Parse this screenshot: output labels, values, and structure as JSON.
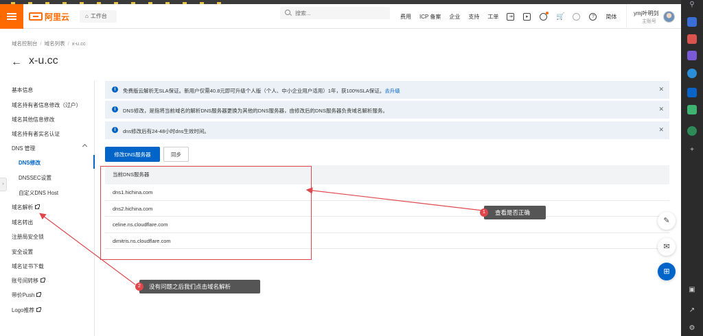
{
  "header": {
    "logo_text": "阿里云",
    "workbench": "工作台",
    "search_placeholder": "搜索...",
    "nav": [
      "费用",
      "ICP 备案",
      "企业",
      "支持",
      "工单"
    ],
    "lang": "简体",
    "user_name": "ymj叶明剑",
    "user_sub": "主账号"
  },
  "breadcrumb": [
    "域名控制台",
    "域名列表",
    "x-u.cc"
  ],
  "page_title": "x-u.cc",
  "sidebar": {
    "items": [
      {
        "label": "基本信息"
      },
      {
        "label": "域名持有者信息修改（过户）"
      },
      {
        "label": "域名其他信息修改"
      },
      {
        "label": "域名持有者实名认证"
      },
      {
        "label": "DNS 管理"
      },
      {
        "label": "DNS修改"
      },
      {
        "label": "DNSSEC设置"
      },
      {
        "label": "自定义DNS Host"
      },
      {
        "label": "域名解析"
      },
      {
        "label": "域名转出"
      },
      {
        "label": "注册局安全锁"
      },
      {
        "label": "安全设置"
      },
      {
        "label": "域名证书下载"
      },
      {
        "label": "账号间转移"
      },
      {
        "label": "带价Push"
      },
      {
        "label": "Logo推荐"
      }
    ]
  },
  "notices": [
    {
      "text": "免费版云解析无SLA保证。新用户仅需40.8元即可升级个人版（个人、中小企业用户适用）1年，获100%SLA保证。",
      "link": "去升级"
    },
    {
      "text": "DNS修改，是指将当前域名的解析DNS服务器更换为其他的DNS服务器，由修改后的DNS服务器负责域名解析服务。",
      "link": ""
    },
    {
      "text": "dns修改后有24-48小时dns生效时间。",
      "link": ""
    }
  ],
  "buttons": {
    "modify_dns": "修改DNS服务器",
    "sync": "同步"
  },
  "dns_table": {
    "header": "当前DNS服务器",
    "rows": [
      "dns1.hichina.com",
      "dns2.hichina.com",
      "celine.ns.cloudflare.com",
      "dimitris.ns.cloudflare.com"
    ]
  },
  "annotations": [
    {
      "num": "1",
      "text": "查看是否正确"
    },
    {
      "num": "2",
      "text": "没有问题之后我们点击域名解析"
    }
  ],
  "colors": {
    "brand": "#ff6a00",
    "primary": "#0064c8",
    "annotation_red": "#e0474c",
    "notice_bg": "#ebf1f6"
  }
}
